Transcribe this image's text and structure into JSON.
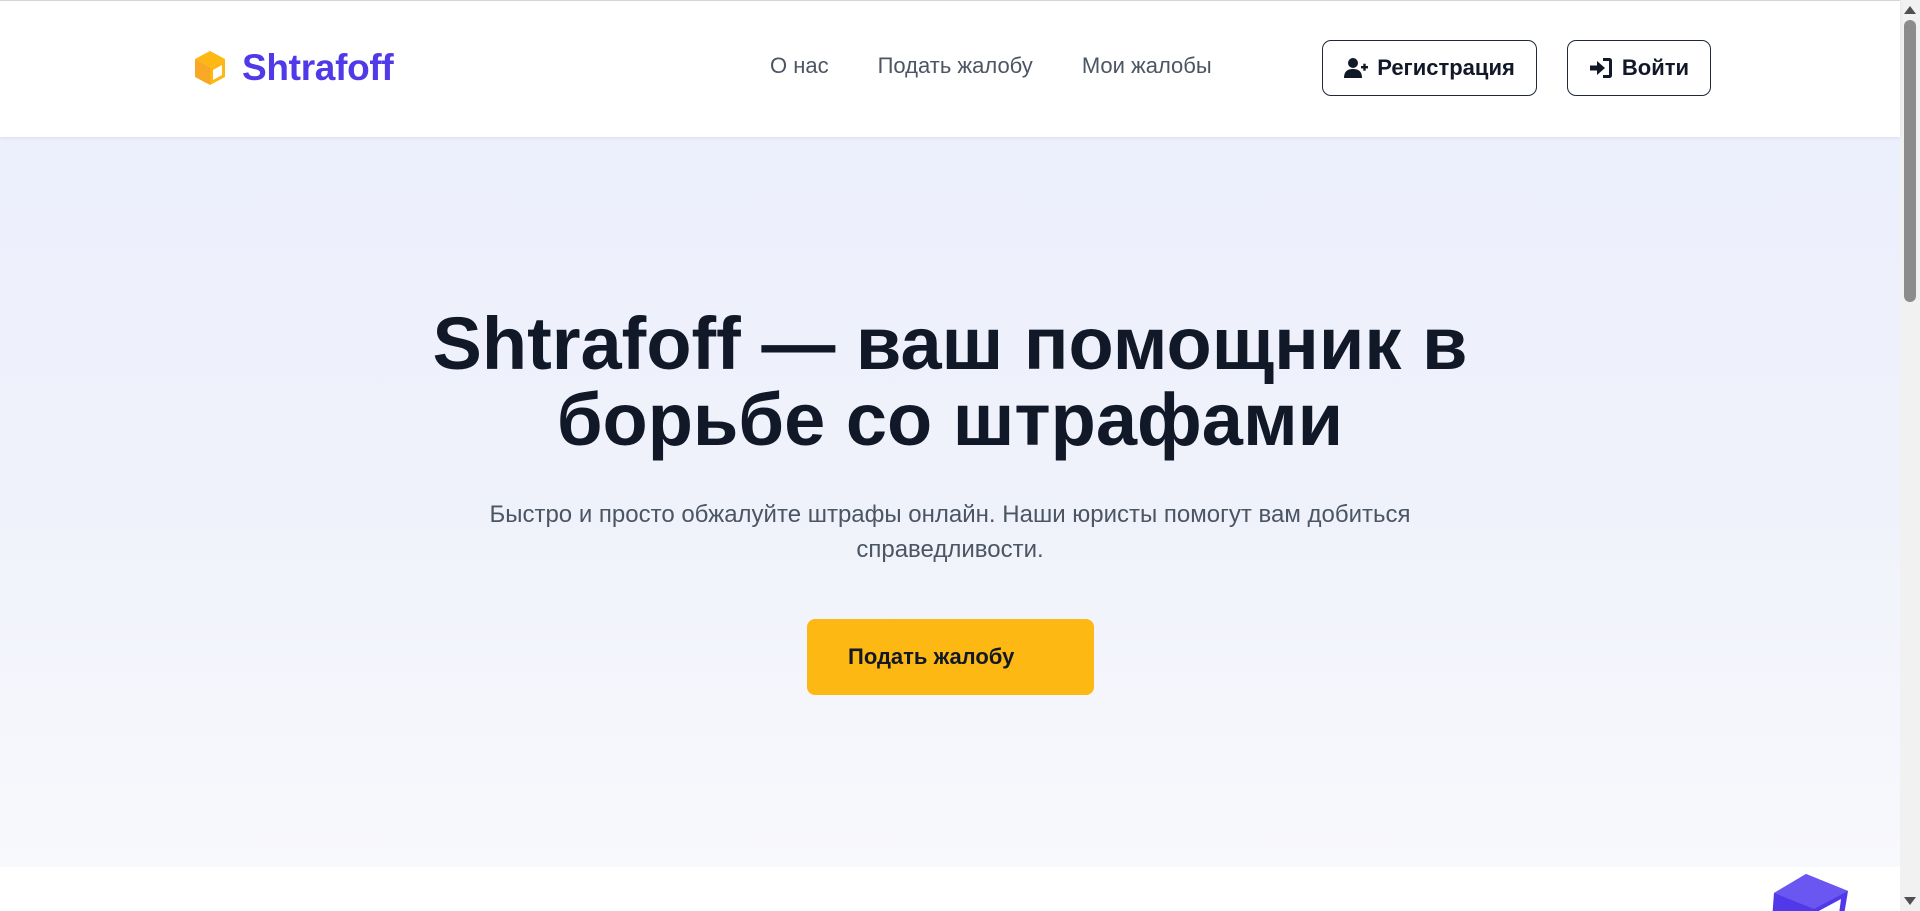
{
  "header": {
    "brand": "Shtrafoff",
    "brand_color": "#4f39e8",
    "logo_icon": "cube-icon",
    "logo_icon_color": "#fdb813",
    "nav": [
      {
        "label": "О нас"
      },
      {
        "label": "Подать жалобу"
      },
      {
        "label": "Мои жалобы"
      }
    ],
    "register_label": "Регистрация",
    "register_icon": "user-plus-icon",
    "login_label": "Войти",
    "login_icon": "sign-in-icon"
  },
  "hero": {
    "title_line1": "Shtrafoff — ваш помощник в",
    "title_line2": "борьбе со штрафами",
    "subtitle_line1": "Быстро и просто обжалуйте штрафы онлайн. Наши юристы помогут вам добиться",
    "subtitle_line2": "справедливости.",
    "cta_label": "Подать жалобу",
    "cta_color": "#fdb813"
  },
  "floating_widget": {
    "icon": "cube-icon",
    "color": "#4f39e8"
  }
}
